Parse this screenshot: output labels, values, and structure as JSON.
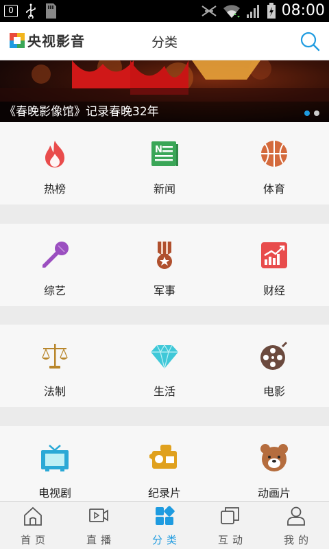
{
  "status_bar": {
    "notification_count": "0",
    "time": "08:00"
  },
  "header": {
    "logo_text": "央视影音",
    "title": "分类"
  },
  "banner": {
    "caption": "《春晚影像馆》记录春晚32年",
    "slide_count": 2,
    "active_slide": 1
  },
  "categories": [
    [
      {
        "label": "热榜",
        "icon": "flame-icon"
      },
      {
        "label": "新闻",
        "icon": "newspaper-icon"
      },
      {
        "label": "体育",
        "icon": "basketball-icon"
      }
    ],
    [
      {
        "label": "综艺",
        "icon": "microphone-icon"
      },
      {
        "label": "军事",
        "icon": "medal-icon"
      },
      {
        "label": "财经",
        "icon": "chart-icon"
      }
    ],
    [
      {
        "label": "法制",
        "icon": "scales-icon"
      },
      {
        "label": "生活",
        "icon": "diamond-icon"
      },
      {
        "label": "电影",
        "icon": "film-reel-icon"
      }
    ],
    [
      {
        "label": "电视剧",
        "icon": "tv-icon"
      },
      {
        "label": "纪录片",
        "icon": "camera-icon"
      },
      {
        "label": "动画片",
        "icon": "bear-icon"
      }
    ]
  ],
  "tabs": [
    {
      "label": "首页",
      "icon": "home-icon",
      "active": false
    },
    {
      "label": "直播",
      "icon": "live-icon",
      "active": false
    },
    {
      "label": "分类",
      "icon": "category-icon",
      "active": true
    },
    {
      "label": "互动",
      "icon": "interact-icon",
      "active": false
    },
    {
      "label": "我的",
      "icon": "profile-icon",
      "active": false
    }
  ],
  "colors": {
    "accent": "#1e9be0",
    "flame": "#e94c4c",
    "news": "#3aa657",
    "sports": "#d46a3c",
    "variety": "#9b4fc0",
    "military": "#b0502e",
    "finance": "#e84c4c",
    "law": "#b8862b",
    "life": "#3fc8d8",
    "movie": "#6b4a3e",
    "tv": "#2aa9d6",
    "documentary": "#e0a11e",
    "animation": "#b56d3e"
  }
}
